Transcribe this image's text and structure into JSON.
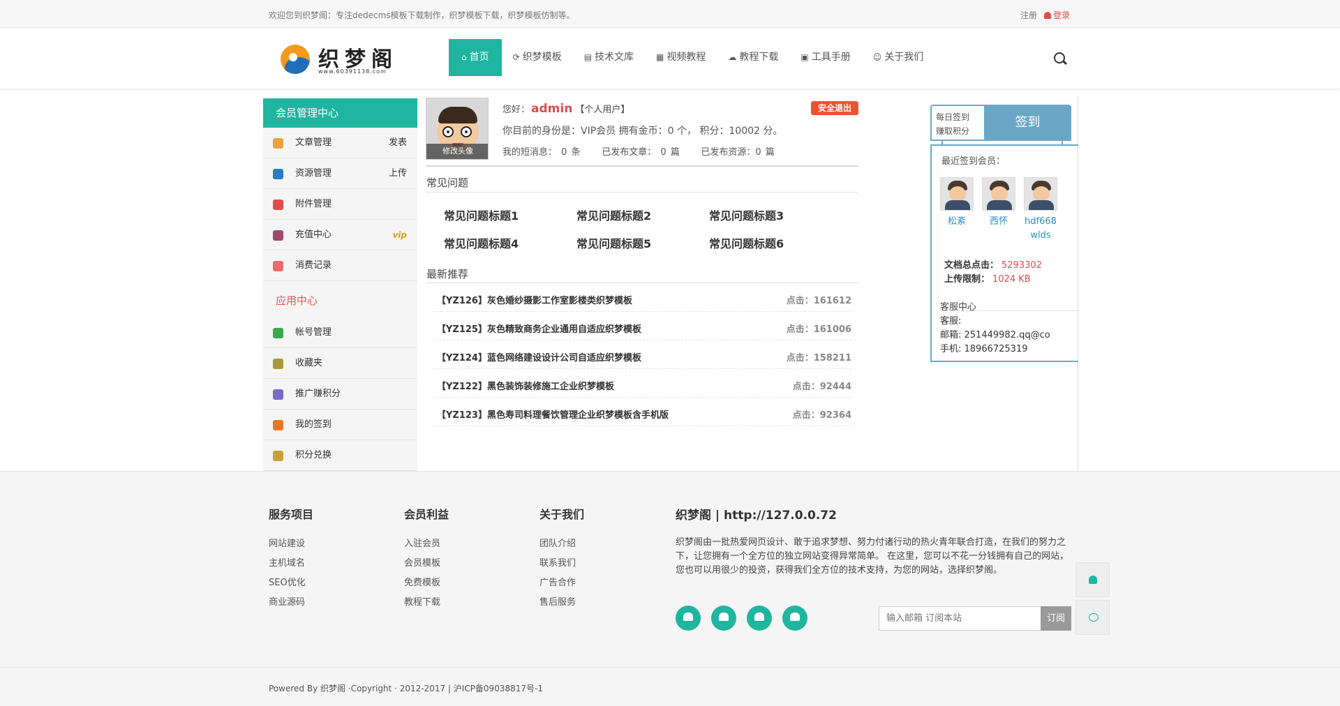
{
  "topbar": {
    "welcome": "欢迎您到织梦阁：专注dedecms模板下载制作，织梦模板下载，织梦模板仿制等。",
    "register": "注册",
    "login": "登录"
  },
  "logo": {
    "name": "织梦阁",
    "url": "www.60391138.com"
  },
  "nav": {
    "items": [
      {
        "label": "首页",
        "icon": "home-icon"
      },
      {
        "label": "织梦模板",
        "icon": "refresh-icon"
      },
      {
        "label": "技术文库",
        "icon": "file-icon"
      },
      {
        "label": "视频教程",
        "icon": "film-icon"
      },
      {
        "label": "教程下载",
        "icon": "cloud-download-icon"
      },
      {
        "label": "工具手册",
        "icon": "manual-icon"
      },
      {
        "label": "关于我们",
        "icon": "smile-icon"
      }
    ],
    "search_icon": "search-icon"
  },
  "sidebar": {
    "title": "会员管理中心",
    "items": [
      {
        "label": "文章管理",
        "right": "发表",
        "color": "#e8a33a"
      },
      {
        "label": "资源管理",
        "right": "上传",
        "color": "#2a7cc7"
      },
      {
        "label": "附件管理",
        "right": "",
        "color": "#e24b4b"
      },
      {
        "label": "充值中心",
        "right": "vip",
        "color": "#a14a6a"
      },
      {
        "label": "消费记录",
        "right": "",
        "color": "#e86c6c"
      }
    ],
    "app_title": "应用中心",
    "app_items": [
      {
        "label": "帐号管理",
        "color": "#3aa74a"
      },
      {
        "label": "收藏夹",
        "color": "#a89a3a"
      },
      {
        "label": "推广赚积分",
        "color": "#7a6bc7"
      },
      {
        "label": "我的签到",
        "color": "#e8772a"
      },
      {
        "label": "积分兑换",
        "color": "#c7a23a"
      }
    ]
  },
  "profile": {
    "edit_avatar": "修改头像",
    "greeting": "您好：",
    "username": "admin",
    "user_type": "【个人用户】",
    "logout": "安全退出",
    "status": "你目前的身份是：VIP会员 拥有金币：0 个， 积分：10002 分。",
    "counts": "我的短消息： 0 条     已发布文章： 0 篇     已发布资源：0 篇"
  },
  "faq": {
    "title": "常见问题",
    "items": [
      "常见问题标题1",
      "常见问题标题2",
      "常见问题标题3",
      "常见问题标题4",
      "常见问题标题5",
      "常见问题标题6"
    ]
  },
  "recommend": {
    "title": "最新推荐",
    "items": [
      {
        "title": "【YZ126】灰色婚纱摄影工作室影楼类织梦模板",
        "clicks": "点击：161612"
      },
      {
        "title": "【YZ125】灰色精致商务企业通用自适应织梦模板",
        "clicks": "点击：161006"
      },
      {
        "title": "【YZ124】蓝色网络建设设计公司自适应织梦模板",
        "clicks": "点击：158211"
      },
      {
        "title": "【YZ122】黑色装饰装修施工企业织梦模板",
        "clicks": "点击：92444"
      },
      {
        "title": "【YZ123】黑色寿司料理餐饮管理企业织梦模板含手机版",
        "clicks": "点击：92364"
      }
    ]
  },
  "signin": {
    "label_line1": "每日签到",
    "label_line2": "赚取积分",
    "button": "签到",
    "recent_title": "最近签到会员：",
    "members": [
      "松紊",
      "西怀",
      "hdf668 wlds"
    ],
    "doc_clicks_label": "文档总点击：",
    "doc_clicks": "5293302",
    "upload_limit_label": "上传限制：",
    "upload_limit": "1024 KB",
    "service_title": "客服中心",
    "service": "客服:",
    "email": "邮箱:  251449982.qq@co",
    "phone": "手机:  18966725319"
  },
  "footer": {
    "col1": {
      "title": "服务项目",
      "links": [
        "网站建设",
        "主机域名",
        "SEO优化",
        "商业源码"
      ]
    },
    "col2": {
      "title": "会员利益",
      "links": [
        "入驻会员",
        "会员模板",
        "免费模板",
        "教程下载"
      ]
    },
    "col3": {
      "title": "关于我们",
      "links": [
        "团队介绍",
        "联系我们",
        "广告合作",
        "售后服务"
      ]
    },
    "about_title": "织梦阁 | http://127.0.0.72",
    "about_text": "织梦阁由一批热爱网页设计、敢于追求梦想、努力付诸行动的热火青年联合打造，在我们的努力之下，让您拥有一个全方位的独立网站变得异常简单。 在这里，您可以不花一分钱拥有自己的网站，您也可以用很少的投资，获得我们全方位的技术支持，为您的网站，选择织梦阁。",
    "subscribe_placeholder": "输入邮箱 订阅本站",
    "subscribe_button": "订阅",
    "copyright": "Powered By 织梦阁 ·Copyright · 2012-2017 | 沪ICP备09038817号-1"
  },
  "colors": {
    "accent": "#1fb5a0",
    "danger": "#e24b4b",
    "sign": "#6aa7c6"
  }
}
